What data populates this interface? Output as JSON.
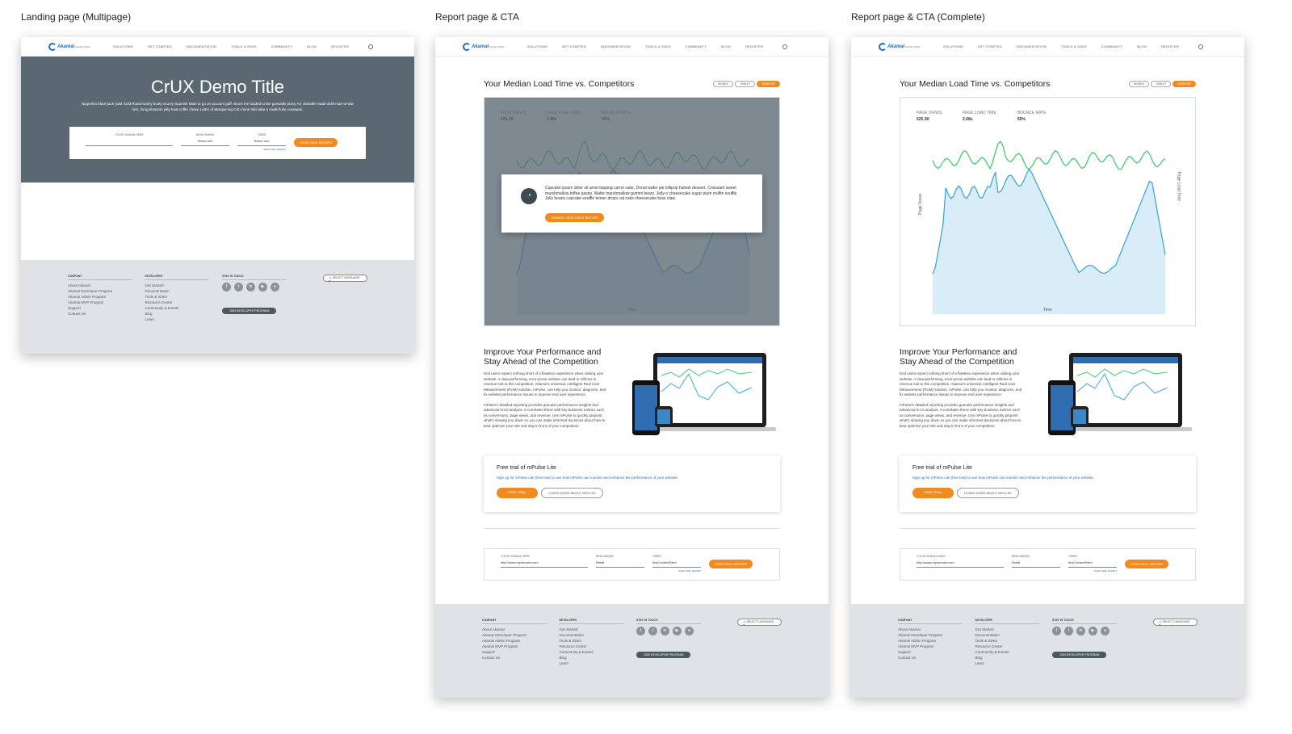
{
  "boards": {
    "landing": "Landing page (Multipage)",
    "report": "Report page & CTA",
    "complete": "Report page & CTA (Complete)"
  },
  "nav": {
    "logo": "Akamai",
    "logo_sub": "DEVELOPER",
    "items": [
      "SOLUTIONS",
      "GET STARTED",
      "DOCUMENTATION",
      "TOOLS & SDKS",
      "COMMUNITY",
      "BLOG",
      "REGISTER"
    ]
  },
  "hero": {
    "title": "CrUX Demo Title",
    "subtitle": "Nipperkin black jack yawl Gold Road mutiny booty scurvy Spanish Main to go on account gaff. Boom lee loaded to the gunwalls provy Arr chandler swab draft man-of-war rum. Grog blossom jolly boat coffer chase Letter of Marque log Cat o'nine tails take a caulk fluke coxswain."
  },
  "form": {
    "domain_label": "YOUR DOMAIN HERE",
    "benchmark_label": "BENCHMARK",
    "timer_label": "TIMER",
    "select_placeholder": "Select one",
    "help_link": "WHAT ARE THESE?",
    "submit": "VIEW CRUX REPORT",
    "domain_value": "http://www.mydomain.com",
    "benchmark_value": "Retail",
    "timer_value": "firstContentPaint"
  },
  "report": {
    "title": "Your Median Load Time vs. Competitors",
    "toggles": [
      "MOBILE",
      "TABLET",
      "DESKTOP"
    ],
    "metrics": [
      {
        "label": "PAGE VIEWS",
        "value": "625.3K"
      },
      {
        "label": "PAGE LOAD TIME",
        "value": "2.68s"
      },
      {
        "label": "BOUNCE RATE",
        "value": "50%"
      }
    ],
    "xlabel": "Time",
    "ylabel_left": "Page Views",
    "ylabel_right": "Page Load Time"
  },
  "cta": {
    "text": "Cupcake ipsum dolor sit amet topping carrot cake. Donut wafer pie lollipop halvah dessert. Croissant sweet marshmallow toffee pastry. Wafer marshmallow gummi bears. Jelly-o cheesecake sugar plum muffin soufflé. Jelly beans cupcake soufflé lemon drops cat cake cheesecake bear claw.",
    "button": "THANKS, VIEW CRUX REPORT"
  },
  "improve": {
    "title": "Improve Your Performance and Stay Ahead of the Competition",
    "para1": "End users expect nothing short of a flawless experience when visiting your website. A slow-performing, error-prone website can lead to millions in revenue lost to the competition. Akamai's universal, intelligent Real User Measurement (RUM) solution, mPulse, can help you monitor, diagnose, and fix website performance issues to improve end user experience.",
    "para2": "mPulse's detailed reporting provides granular performance insights and advanced error analysis. It correlates these with key business metrics such as conversions, page views, and revenue. Use mPulse to quickly pinpoint what's slowing you down so you can make informed decisions about how to best optimize your site and stay in front of your competitors."
  },
  "trial": {
    "title": "Free trial of mPulse Lite",
    "subtitle": "Sign up for mPulse Lite (free trial) to see how mPulse can monitor and enhance the performance of your website.",
    "primary": "FREE TRIAL",
    "secondary": "LEARN MORE ABOUT MPULSE"
  },
  "footer": {
    "company_title": "COMPANY",
    "company_items": [
      "About Akamai",
      "Akamai Developer Program",
      "Akamai Admin Program",
      "Akamai MVP Program",
      "Support",
      "Contact Us"
    ],
    "developer_title": "DEVELOPER",
    "developer_items": [
      "Get Started",
      "Documentation",
      "Tools & SDKs",
      "Resource Center",
      "Community & Events",
      "Blog",
      "Learn"
    ],
    "touch_title": "STAY IN TOUCH",
    "join": "JOIN DEVELOPER PROGRAM",
    "language": "SELECT LANGUAGE"
  },
  "colors": {
    "accent": "#f28a1e",
    "hero": "#5b6872",
    "link": "#1b6fbf",
    "green_series": "#3fce6e",
    "blue_series": "#3fa8d8"
  }
}
